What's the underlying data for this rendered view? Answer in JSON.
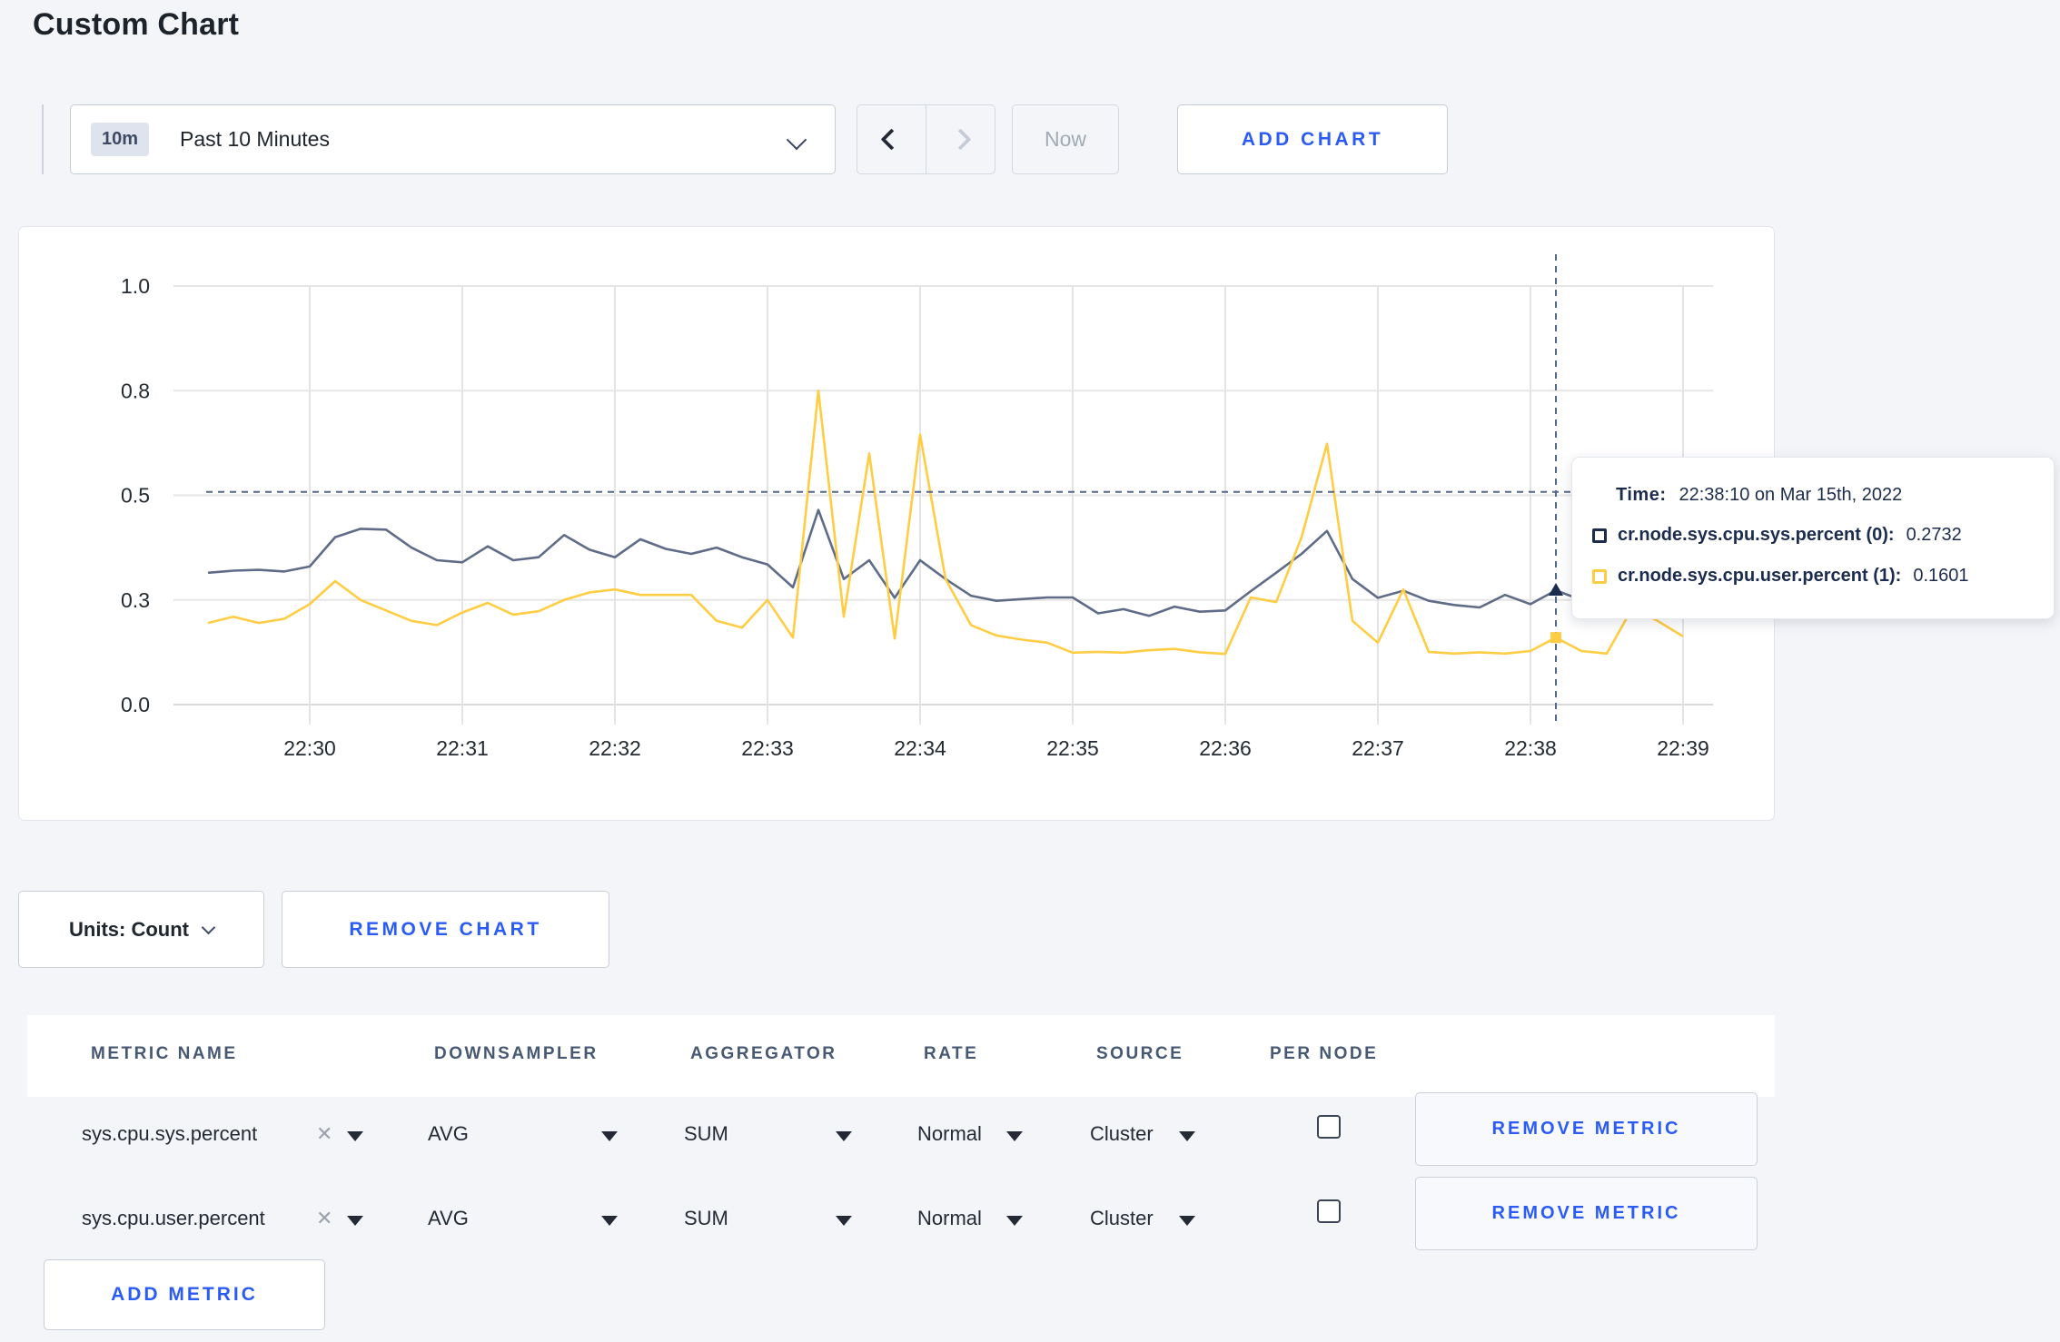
{
  "page": {
    "title": "Custom Chart"
  },
  "toolbar": {
    "time_range": {
      "badge": "10m",
      "label": "Past 10 Minutes"
    },
    "now_label": "Now",
    "add_chart_label": "ADD CHART"
  },
  "icons": {
    "clear_glyph": "✕"
  },
  "colors": {
    "accent_blue": "#2b5bf7",
    "series_sys_line": "#5f6c87",
    "series_sys_swatch": "#1c2c4f",
    "series_user_line": "#ffcd44",
    "page_background": "#f4f5f9",
    "slate_header": "#475872"
  },
  "chart_data": {
    "type": "line",
    "title": "",
    "xlabel": "",
    "ylabel": "",
    "ylim": [
      0,
      1
    ],
    "grid": true,
    "legend_position": "tooltip-only",
    "x_start": "22:29:20",
    "x_end": "22:39:00",
    "x_interval_seconds": 10,
    "x_tick_labels": [
      "22:30",
      "22:31",
      "22:32",
      "22:33",
      "22:34",
      "22:35",
      "22:36",
      "22:37",
      "22:38",
      "22:39"
    ],
    "y_tick_labels": [
      "0.0",
      "0.3",
      "0.5",
      "0.8",
      "1.0"
    ],
    "y_tick_values": [
      0,
      0.25,
      0.5,
      0.75,
      1.0
    ],
    "series": [
      {
        "name": "cr.node.sys.cpu.sys.percent (0)",
        "color": "#5f6c87",
        "values": [
          0.315,
          0.32,
          0.322,
          0.318,
          0.33,
          0.4,
          0.42,
          0.418,
          0.375,
          0.345,
          0.34,
          0.378,
          0.345,
          0.352,
          0.405,
          0.37,
          0.352,
          0.395,
          0.372,
          0.36,
          0.375,
          0.352,
          0.335,
          0.28,
          0.465,
          0.3,
          0.345,
          0.255,
          0.345,
          0.3,
          0.26,
          0.248,
          0.252,
          0.256,
          0.256,
          0.218,
          0.228,
          0.212,
          0.234,
          0.222,
          0.225,
          0.271,
          0.315,
          0.36,
          0.415,
          0.3,
          0.255,
          0.272,
          0.248,
          0.238,
          0.232,
          0.262,
          0.24,
          0.273,
          0.25,
          0.24,
          0.235,
          0.235,
          0.232
        ]
      },
      {
        "name": "cr.node.sys.cpu.user.percent (1)",
        "color": "#ffcd44",
        "values": [
          0.195,
          0.21,
          0.195,
          0.205,
          0.24,
          0.295,
          0.25,
          0.225,
          0.2,
          0.19,
          0.22,
          0.243,
          0.215,
          0.223,
          0.25,
          0.268,
          0.275,
          0.262,
          0.262,
          0.262,
          0.2,
          0.184,
          0.25,
          0.16,
          0.75,
          0.21,
          0.6,
          0.158,
          0.645,
          0.3,
          0.19,
          0.165,
          0.155,
          0.148,
          0.124,
          0.126,
          0.124,
          0.13,
          0.133,
          0.125,
          0.121,
          0.256,
          0.245,
          0.4,
          0.623,
          0.2,
          0.148,
          0.275,
          0.126,
          0.122,
          0.125,
          0.122,
          0.128,
          0.16,
          0.128,
          0.122,
          0.23,
          0.2,
          0.163
        ]
      }
    ],
    "crosshair": {
      "time": "22:38:10",
      "x_index": 53,
      "h_line_value": 0.508,
      "marker_values": [
        0.2732,
        0.1601
      ]
    }
  },
  "tooltip": {
    "time_label": "Time:",
    "time_value": "22:38:10 on Mar 15th, 2022",
    "rows": [
      {
        "name": "cr.node.sys.cpu.sys.percent (0):",
        "value": "0.2732"
      },
      {
        "name": "cr.node.sys.cpu.user.percent (1):",
        "value": "0.1601"
      }
    ]
  },
  "chart_controls": {
    "units_label": "Units: Count",
    "remove_chart_label": "REMOVE CHART"
  },
  "metrics_table": {
    "headers": [
      "METRIC NAME",
      "DOWNSAMPLER",
      "AGGREGATOR",
      "RATE",
      "SOURCE",
      "PER NODE"
    ],
    "rows": [
      {
        "metric": "sys.cpu.sys.percent",
        "downsampler": "AVG",
        "aggregator": "SUM",
        "rate": "Normal",
        "source": "Cluster",
        "per_node": false,
        "remove_label": "REMOVE METRIC"
      },
      {
        "metric": "sys.cpu.user.percent",
        "downsampler": "AVG",
        "aggregator": "SUM",
        "rate": "Normal",
        "source": "Cluster",
        "per_node": false,
        "remove_label": "REMOVE METRIC"
      }
    ],
    "add_metric_label": "ADD METRIC"
  }
}
